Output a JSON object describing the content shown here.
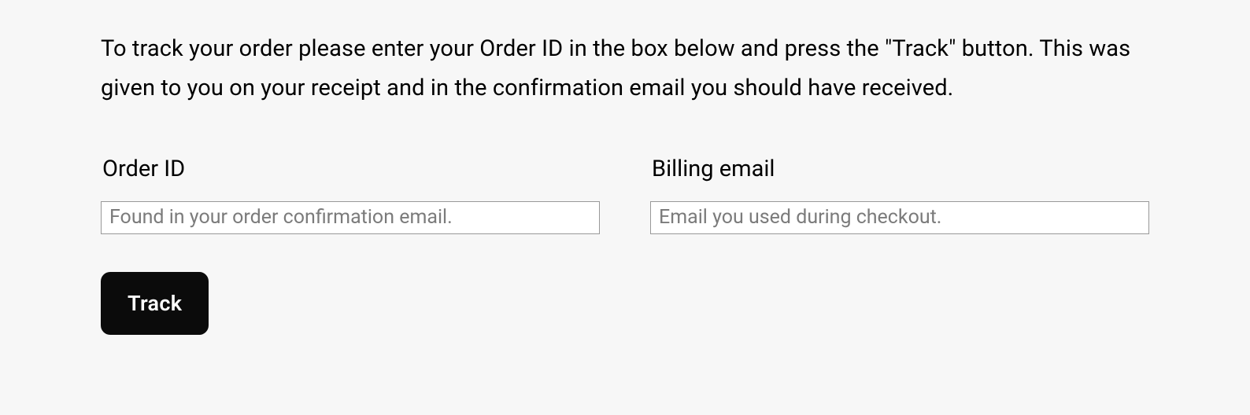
{
  "intro_text": "To track your order please enter your Order ID in the box below and press the \"Track\" button. This was given to you on your receipt and in the confirmation email you should have received.",
  "form": {
    "order_id": {
      "label": "Order ID",
      "placeholder": "Found in your order confirmation email.",
      "value": ""
    },
    "billing_email": {
      "label": "Billing email",
      "placeholder": "Email you used during checkout.",
      "value": ""
    },
    "submit_label": "Track"
  }
}
